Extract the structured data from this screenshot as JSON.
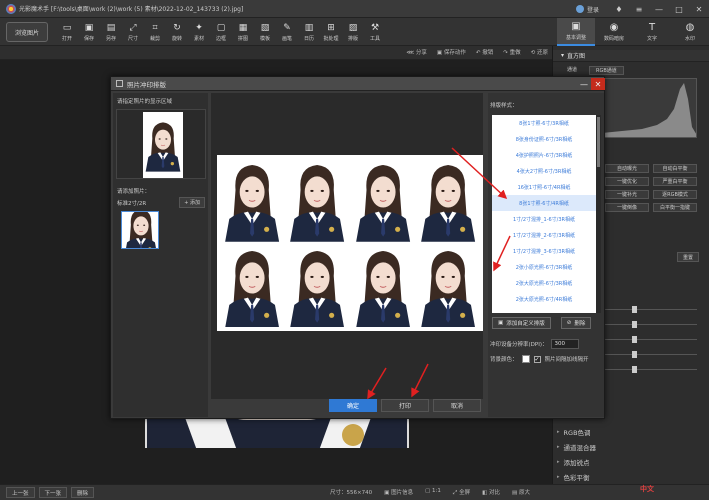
{
  "window": {
    "title": "光影魔术手 [F:\\tools\\桌面\\work (2)\\work (5) 素材\\2022-12-02_143733 (2).jpg]",
    "login": "登录"
  },
  "toolbar": {
    "browse": "浏览图片",
    "tools": [
      {
        "label": "打开",
        "icon": "folder-icon",
        "glyph": "▭"
      },
      {
        "label": "保存",
        "icon": "save-icon",
        "glyph": "▣"
      },
      {
        "label": "另存",
        "icon": "save-as-icon",
        "glyph": "▤"
      },
      {
        "label": "尺寸",
        "icon": "resize-icon",
        "glyph": "⤢"
      },
      {
        "label": "裁剪",
        "icon": "crop-icon",
        "glyph": "⌗"
      },
      {
        "label": "旋转",
        "icon": "rotate-icon",
        "glyph": "↻"
      },
      {
        "label": "素材",
        "icon": "material-icon",
        "glyph": "✦"
      },
      {
        "label": "边框",
        "icon": "border-icon",
        "glyph": "▢"
      },
      {
        "label": "拼图",
        "icon": "collage-icon",
        "glyph": "▦"
      },
      {
        "label": "模板",
        "icon": "template-icon",
        "glyph": "▧"
      },
      {
        "label": "画笔",
        "icon": "brush-icon",
        "glyph": "✎"
      },
      {
        "label": "日历",
        "icon": "calendar-icon",
        "glyph": "▥"
      },
      {
        "label": "批处理",
        "icon": "batch-icon",
        "glyph": "⊞"
      },
      {
        "label": "排版",
        "icon": "layout-icon",
        "glyph": "▨"
      },
      {
        "label": "工具",
        "icon": "tools-icon",
        "glyph": "⚒"
      }
    ],
    "right_tabs": [
      {
        "label": "基本调整",
        "icon": "adjust-icon",
        "glyph": "▣"
      },
      {
        "label": "数码暗房",
        "icon": "darkroom-icon",
        "glyph": "◉"
      },
      {
        "label": "文字",
        "icon": "text-icon",
        "glyph": "T"
      },
      {
        "label": "水印",
        "icon": "watermark-icon",
        "glyph": "◍"
      }
    ]
  },
  "subbar": {
    "share": "分享",
    "save_action": "保存动作",
    "undo": "撤销",
    "redo": "重做",
    "restore": "还原"
  },
  "right_panel": {
    "histogram_title": "直方图",
    "hist_tabs": [
      "通道",
      "RGB通道"
    ],
    "buttons": [
      "自动曝光",
      "自动白平衡",
      "一键优化",
      "严重白平衡",
      "一键补光",
      "逐RGB模式",
      "一键倒像",
      "白平衡一指键"
    ],
    "preset": "重置",
    "slider_levels": [
      0.5,
      0.5,
      0.5,
      0.5,
      0.5
    ],
    "list": [
      "RGB色调",
      "通道混合器",
      "添加锐点",
      "色彩平衡"
    ]
  },
  "dialog": {
    "title": "照片冲印排版",
    "crop_label": "请指定照片的显示区域",
    "add_photo_label": "请添加照片：",
    "standard": "标准2寸/2R",
    "add_button": "+ 添加",
    "styles_label": "排版样式：",
    "styles": [
      "8张1寸照-6寸/3R相纸",
      "8张身份证照-6寸/3R相纸",
      "4张护照照片-6寸/3R相纸",
      "4张大2寸照-6寸/3R相纸",
      "16张1寸照-6寸/4R相纸",
      "8张1寸照-6寸/4R相纸",
      "1寸/2寸混排_1-6寸/3R相纸",
      "1寸/2寸混排_2-6寸/3R相纸",
      "1寸/2寸混排_3-6寸/3R相纸",
      "2张小原光照-6寸/3R相纸",
      "2张大原光照-6寸/3R相纸",
      "2张大原光照-6寸/4R相纸"
    ],
    "selected_style": 5,
    "custom_button": "添加自定义排版",
    "delete_button": "删除",
    "dpi_label": "冲印设备分辨率(DPI)：",
    "dpi_value": "300",
    "bg_label": "背景颜色：",
    "gap_label": "照片间隔加线隔开",
    "gap_checked": true,
    "ok": "确定",
    "print": "打印",
    "cancel": "取消"
  },
  "bottombar": {
    "prev": "上一张",
    "next": "下一张",
    "delete": "删除",
    "size_label": "尺寸：",
    "size_value": "556×740",
    "info": "图片信息",
    "zoom_actual": "1:1",
    "fullscreen": "全屏",
    "compare": "对比",
    "original": "原大"
  },
  "watermark_text": "中文"
}
